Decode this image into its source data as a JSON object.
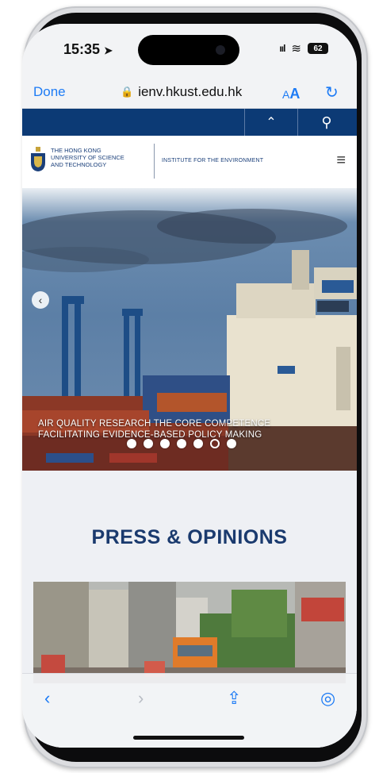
{
  "status": {
    "time": "15:35",
    "location_glyph": "➤",
    "signal_glyph": "ııl",
    "wifi_glyph": "≋",
    "battery_level": "62"
  },
  "browser": {
    "done_label": "Done",
    "url": "ienv.hkust.edu.hk",
    "lock_glyph": "🔒",
    "aa_small": "A",
    "aa_large": "A",
    "reload_glyph": "↻"
  },
  "sitenav": {
    "up_glyph": "⌃",
    "search_glyph": "⚲"
  },
  "site_header": {
    "university_line1": "THE HONG KONG",
    "university_line2": "UNIVERSITY OF SCIENCE",
    "university_line3": "AND TECHNOLOGY",
    "institute": "INSTITUTE FOR THE ENVIRONMENT",
    "menu_glyph": "≡"
  },
  "hero": {
    "prev_glyph": "‹",
    "caption_line1": "AIR QUALITY RESEARCH THE CORE COMPETENCE",
    "caption_line2": "FACILITATING EVIDENCE-BASED POLICY MAKING",
    "slides_total": 7,
    "active_slide": 6
  },
  "section": {
    "title": "PRESS & OPINIONS"
  },
  "toolbar": {
    "back_glyph": "‹",
    "forward_glyph": "›",
    "share_glyph": "⇪",
    "compass_glyph": "◎"
  },
  "colors": {
    "accent": "#1d7bf5",
    "brand_navy": "#0c3a75",
    "heading": "#1a3a6e"
  }
}
